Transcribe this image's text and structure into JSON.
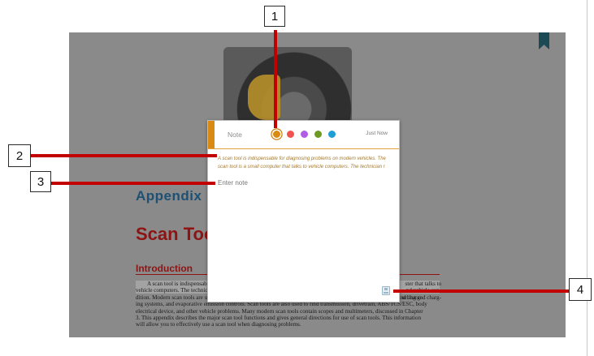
{
  "document": {
    "heading_appendix": "Appendix",
    "heading_scan_tool": "Scan Tool",
    "intro_title": "Introduction",
    "intro_lines": [
      "A scan tool is indispensable for diagnosing problems on modern vehicles. The scan tool is a small computer",
      "vehicle computers. The technician uses the scan tool to retrieve and interpret diagnostic trouble codes and to",
      "dition. Modern scan tools are used on engine, powertrain, body and chassis control, including fuel, idle, sparking and charg-",
      "ing systems, and evaporative emission controls. Scan tools are also used to find transmission, drivetrain, ABS/TCS/ESC, body",
      "electrical device, and other vehicle problems. Many modern scan tools contain scopes and multimeters, discussed in Chapter",
      "3. This appendix describes the major scan tool functions and gives general directions for use of scan tools. This information",
      "will allow you to effectively use a scan tool when diagnosing problems."
    ],
    "right_edge_lines": [
      "ster that talks to",
      "nd vehicle con-",
      "urling and charg-"
    ]
  },
  "note": {
    "title": "Note",
    "timestamp": "Just Now",
    "colors": [
      {
        "name": "orange",
        "hex": "#d98a12",
        "selected": true
      },
      {
        "name": "red",
        "hex": "#ef5350",
        "selected": false
      },
      {
        "name": "purple",
        "hex": "#b05ce5",
        "selected": false
      },
      {
        "name": "green",
        "hex": "#6d9a22",
        "selected": false
      },
      {
        "name": "blue",
        "hex": "#1e9ed6",
        "selected": false
      }
    ],
    "quote_lines": [
      "A scan tool is indispensable for diagnosing problems on modern vehicles. The",
      "scan tool is a small computer that talks to vehicle computers. The technician r"
    ],
    "input_placeholder": "Enter note"
  },
  "callouts": [
    "1",
    "2",
    "3",
    "4"
  ],
  "colors": {
    "annotation_red": "#c30000",
    "bookmark": "#1b4a54",
    "heading_red": "#8e1414",
    "heading_blue": "#1e5073"
  }
}
